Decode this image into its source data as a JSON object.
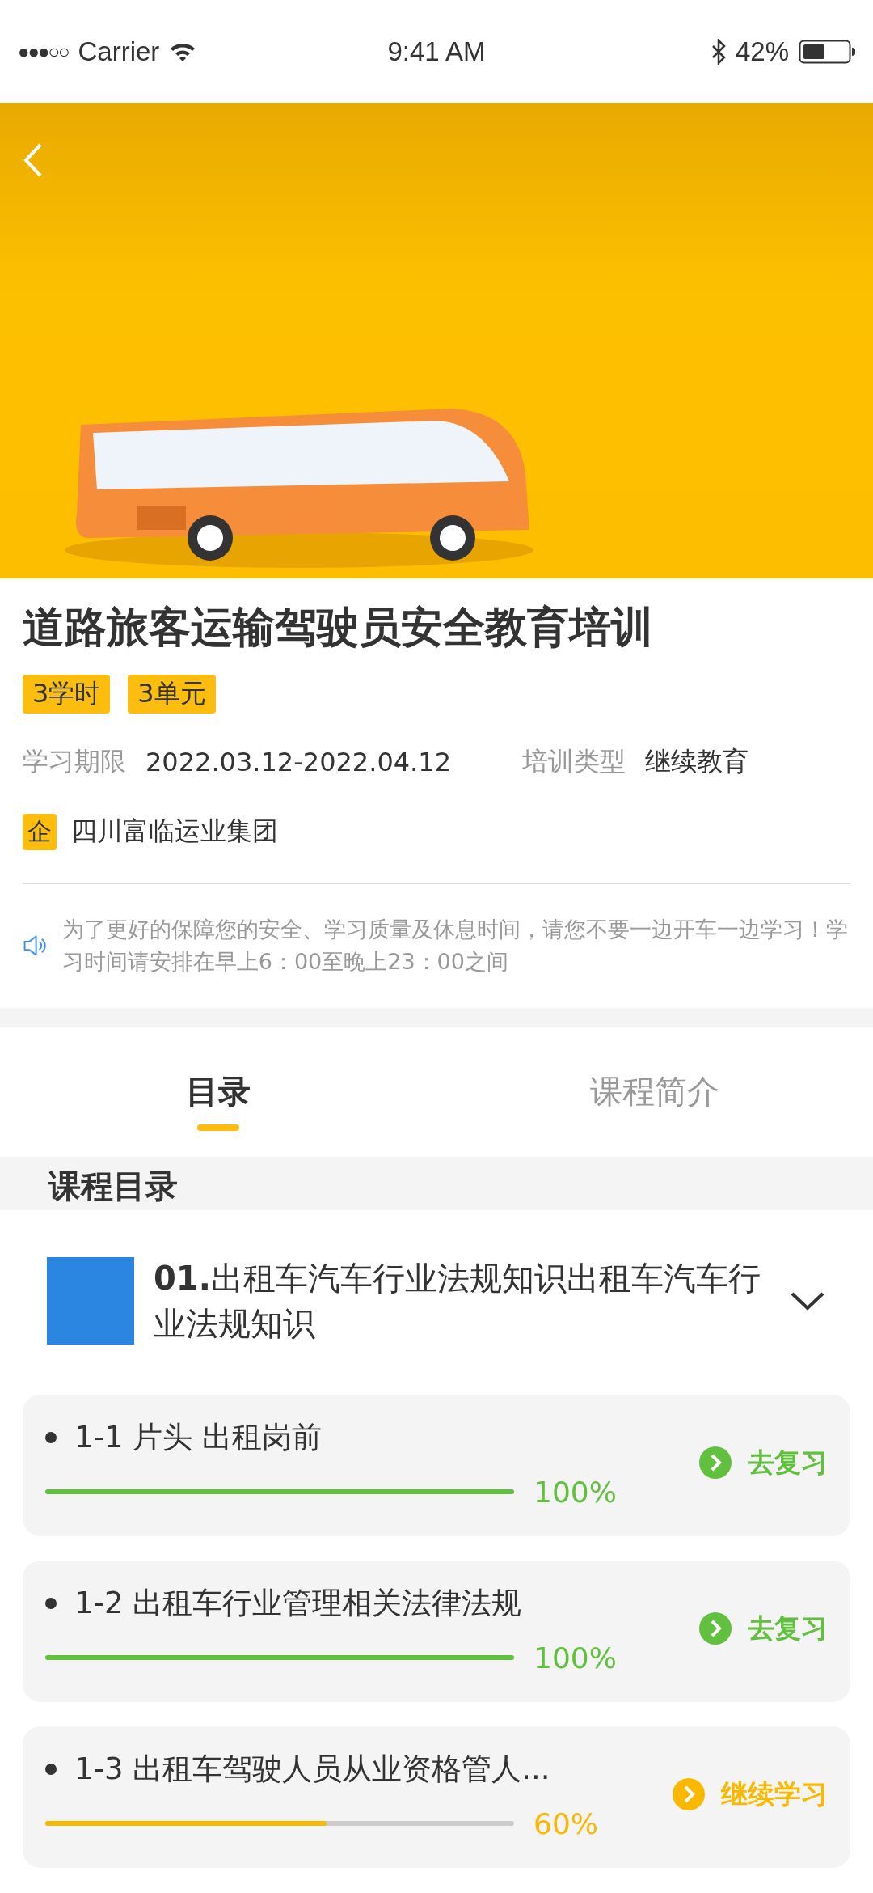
{
  "status_bar": {
    "signal_dots": "●●●○○",
    "carrier": "Carrier",
    "time": "9:41 AM",
    "battery": "42%"
  },
  "course": {
    "title": "道路旅客运输驾驶员安全教育培训",
    "tags": [
      "3学时",
      "3单元"
    ],
    "period_label": "学习期限",
    "period": "2022.03.12-2022.04.12",
    "type_label": "培训类型",
    "type": "继续教育",
    "org_badge": "企",
    "org": "四川富临运业集团",
    "notice": "为了更好的保障您的安全、学习质量及休息时间，请您不要一边开车一边学习！学习时间请安排在早上6：00至晚上23：00之间"
  },
  "tabs": [
    {
      "label": "目录",
      "selected": true
    },
    {
      "label": "课程简介",
      "selected": false
    }
  ],
  "section_title": "课程目录",
  "chapter": {
    "number": "01.",
    "title": "出租车汽车行业法规知识出租车汽车行业法规知识",
    "expanded": false
  },
  "lessons": [
    {
      "title": "1-1  片头 出租岗前",
      "level": 1,
      "percent": "100%",
      "kind": "review",
      "action": "去复习"
    },
    {
      "title": "1-2 出租车行业管理相关法律法规",
      "level": 1,
      "percent": "100%",
      "kind": "review",
      "action": "去复习"
    },
    {
      "title": "1-3 出租车驾驶人员从业资格管人...",
      "level": 0.6,
      "percent": "60%",
      "kind": "continue",
      "action": "继续学习"
    }
  ]
}
